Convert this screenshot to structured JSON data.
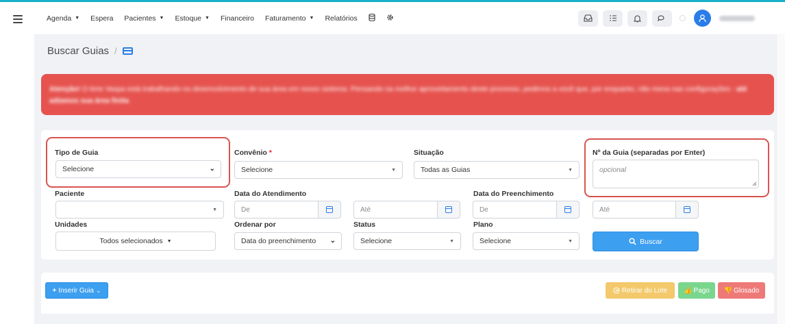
{
  "nav": {
    "items": [
      {
        "label": "Agenda",
        "has_caret": true
      },
      {
        "label": "Espera",
        "has_caret": false
      },
      {
        "label": "Pacientes",
        "has_caret": true
      },
      {
        "label": "Estoque",
        "has_caret": true
      },
      {
        "label": "Financeiro",
        "has_caret": false
      },
      {
        "label": "Faturamento",
        "has_caret": true
      },
      {
        "label": "Relatórios",
        "has_caret": false
      }
    ],
    "icons": [
      "database-icon",
      "gear-icon"
    ],
    "right_icons": [
      "inbox-icon",
      "checklist-icon",
      "bell-icon",
      "chat-icon"
    ]
  },
  "breadcrumb": {
    "title": "Buscar Guias",
    "separator": "/"
  },
  "alert": {
    "prefix": "Atenção!",
    "message": "O time Vaspa está trabalhando no desenvolvimento de sua área em nosso sistema. Pensando na melhor aproveitamento deste processo, pedimos a você que, por enquanto, não mexa nas configurações -",
    "suffix": "até adiamos sua área finita",
    "color": "#e6534f"
  },
  "form": {
    "tipo_guia": {
      "label": "Tipo de Guia",
      "value": "Selecione"
    },
    "convenio": {
      "label": "Convênio",
      "required_mark": "*",
      "value": "Selecione"
    },
    "situacao": {
      "label": "Situação",
      "value": "Todas as Guias"
    },
    "numero_guia": {
      "label": "Nº da Guia (separadas por Enter)",
      "placeholder": "opcional"
    },
    "paciente": {
      "label": "Paciente",
      "value": ""
    },
    "data_atendimento": {
      "label": "Data do Atendimento",
      "from_placeholder": "De",
      "to_placeholder": "Até"
    },
    "data_preenchimento": {
      "label": "Data do Preenchimento",
      "from_placeholder": "De",
      "to_placeholder": "Até"
    },
    "unidades": {
      "label": "Unidades",
      "value": "Todos selecionados"
    },
    "ordenar_por": {
      "label": "Ordenar por",
      "value": "Data do preenchimento"
    },
    "status": {
      "label": "Status",
      "value": "Selecione"
    },
    "plano": {
      "label": "Plano",
      "value": "Selecione"
    },
    "buscar_label": "Buscar"
  },
  "actions": {
    "inserir_label": "Inserir Guia",
    "retirar_label": "Retirar do Lote",
    "pago_label": "Pago",
    "glosado_label": "Glosado"
  },
  "colors": {
    "primary": "#3d9ff0",
    "alert": "#e6534f",
    "highlight": "#d9534f",
    "retirar": "#f3c96b",
    "pago": "#7ad68c",
    "glosado": "#ee7a78"
  }
}
